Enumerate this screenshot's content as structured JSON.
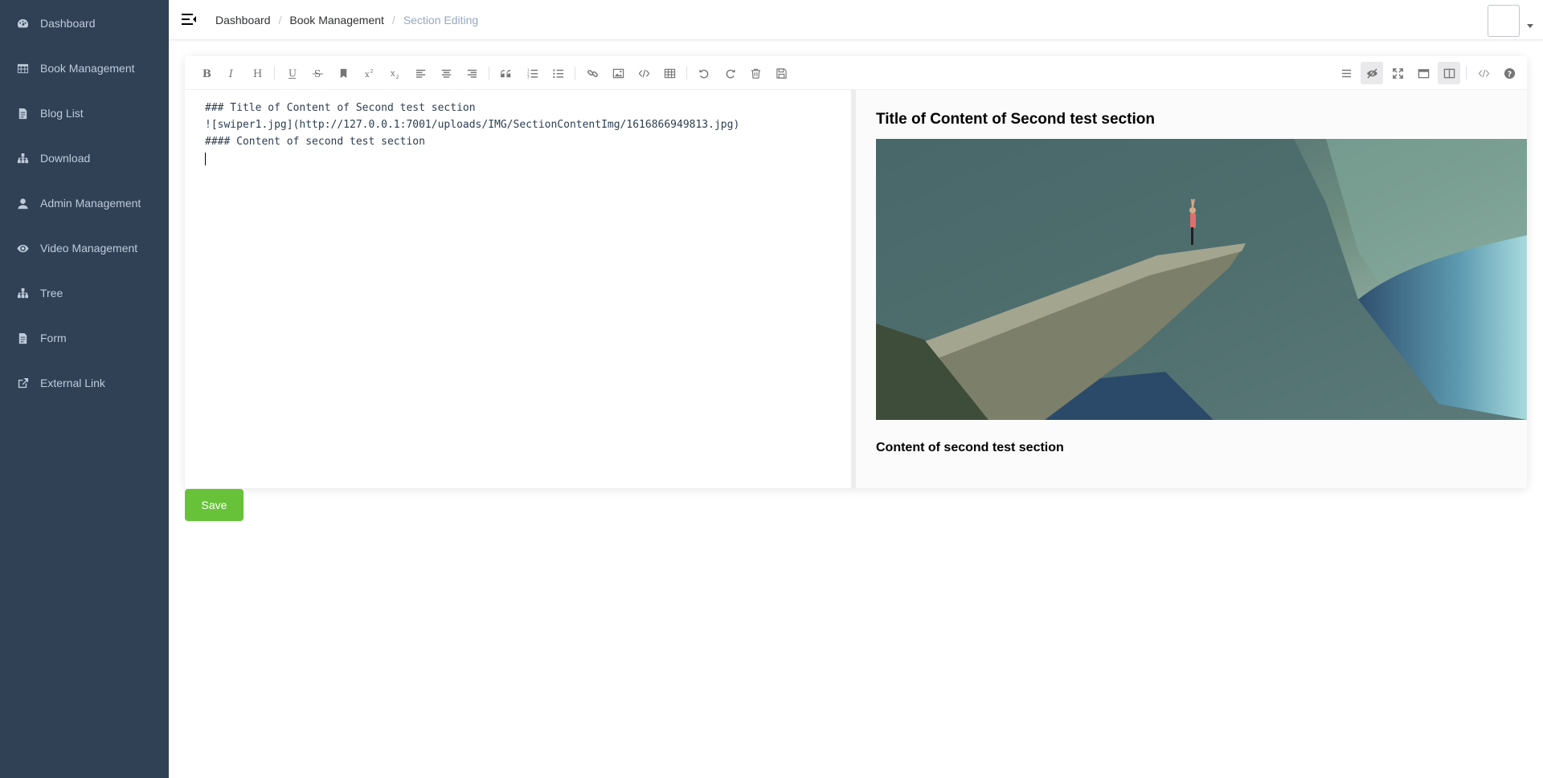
{
  "sidebar": {
    "background": "#304156",
    "items": [
      {
        "label": "Dashboard",
        "icon": "dashboard-icon"
      },
      {
        "label": "Book Management",
        "icon": "table-icon"
      },
      {
        "label": "Blog List",
        "icon": "document-icon"
      },
      {
        "label": "Download",
        "icon": "tree-icon"
      },
      {
        "label": "Admin Management",
        "icon": "user-icon"
      },
      {
        "label": "Video Management",
        "icon": "eye-icon"
      },
      {
        "label": "Tree",
        "icon": "tree-icon"
      },
      {
        "label": "Form",
        "icon": "form-icon"
      },
      {
        "label": "External Link",
        "icon": "external-link-icon"
      }
    ]
  },
  "header": {
    "breadcrumb": [
      "Dashboard",
      "Book Management",
      "Section Editing"
    ],
    "separator": "/"
  },
  "editor": {
    "source_lines": [
      "### Title of Content of Second test section",
      "![swiper1.jpg](http://127.0.0.1:7001/uploads/IMG/SectionContentImg/1616866949813.jpg)",
      "#### Content of second test section"
    ],
    "preview": {
      "title": "Title of Content of Second test section",
      "image_alt": "swiper1.jpg",
      "subtitle": "Content of second test section"
    },
    "toolbar_left_icons": [
      "bold-icon",
      "italic-icon",
      "header-icon",
      "underline-icon",
      "strikethrough-icon",
      "mark-icon",
      "superscript-icon",
      "subscript-icon",
      "align-left-icon",
      "align-center-icon",
      "align-right-icon",
      "quote-icon",
      "ordered-list-icon",
      "unordered-list-icon",
      "link-icon",
      "image-icon",
      "code-icon",
      "table-icon",
      "undo-icon",
      "redo-icon",
      "trash-icon",
      "save-icon"
    ],
    "toolbar_right_icons": [
      "navigation-icon",
      "preview-toggle-icon",
      "fullscreen-icon",
      "read-mode-icon",
      "subfield-icon",
      "html-code-icon",
      "help-icon"
    ]
  },
  "actions": {
    "save_label": "Save",
    "save_color": "#67c23a"
  }
}
